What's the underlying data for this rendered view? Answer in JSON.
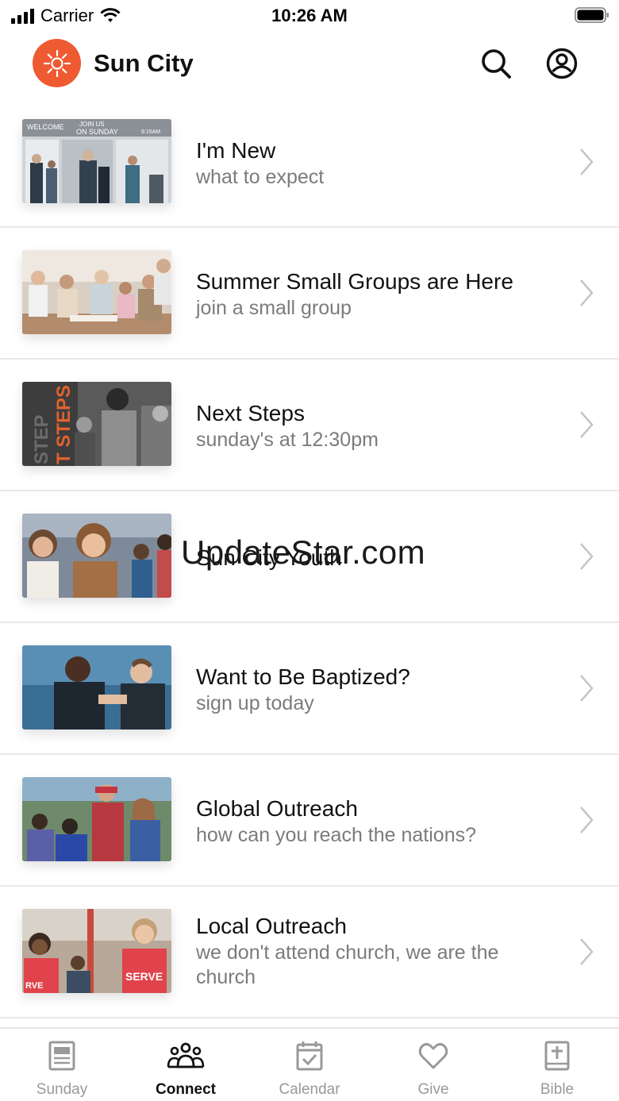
{
  "status_bar": {
    "carrier": "Carrier",
    "time": "10:26 AM"
  },
  "header": {
    "title": "Sun City",
    "brand_color": "#ee5a32"
  },
  "feed": {
    "items": [
      {
        "title": "I'm New",
        "subtitle": "what to expect",
        "icon": "chevron-right-icon"
      },
      {
        "title": "Summer Small Groups are Here",
        "subtitle": "join a small group",
        "icon": "chevron-right-icon"
      },
      {
        "title": "Next Steps",
        "subtitle": "sunday's at 12:30pm",
        "icon": "chevron-right-icon"
      },
      {
        "title": "Sun City Youth",
        "subtitle": "",
        "icon": "chevron-right-icon"
      },
      {
        "title": "Want to Be Baptized?",
        "subtitle": "sign up today",
        "icon": "chevron-right-icon"
      },
      {
        "title": "Global Outreach",
        "subtitle": "how can you reach the nations?",
        "icon": "chevron-right-icon"
      },
      {
        "title": "Local Outreach",
        "subtitle": "we don't attend church, we are the church",
        "icon": "chevron-right-icon"
      }
    ],
    "thumb_texts": {
      "im_new": [
        "WELCOME",
        "JOIN US",
        "ON SUNDAY",
        "9:15AM"
      ],
      "next_steps": "T STEPS",
      "serve": "SERVE"
    }
  },
  "watermark": "UpdateStar.com",
  "tab_bar": {
    "tabs": [
      {
        "label": "Sunday",
        "icon": "newspaper-icon",
        "active": false
      },
      {
        "label": "Connect",
        "icon": "people-icon",
        "active": true
      },
      {
        "label": "Calendar",
        "icon": "calendar-icon",
        "active": false
      },
      {
        "label": "Give",
        "icon": "heart-icon",
        "active": false
      },
      {
        "label": "Bible",
        "icon": "bible-icon",
        "active": false
      }
    ]
  }
}
